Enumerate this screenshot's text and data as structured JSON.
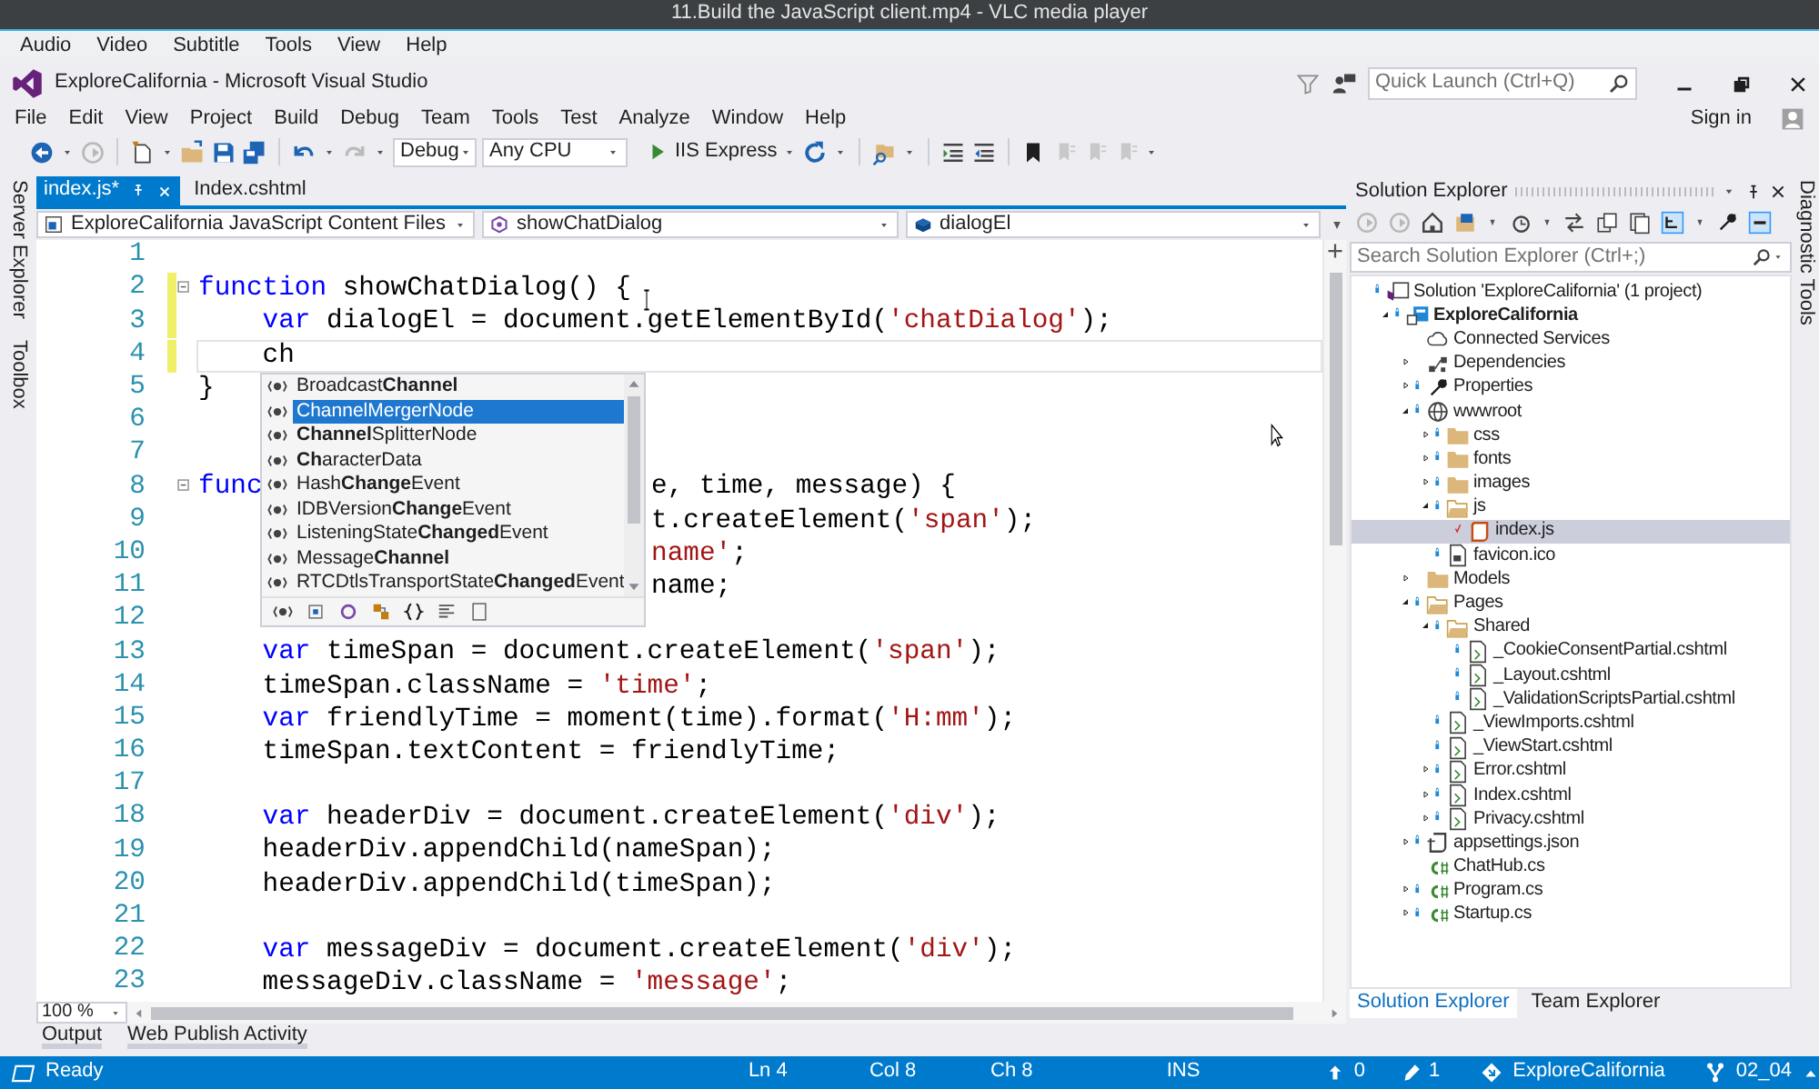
{
  "player": {
    "title": "11.Build the JavaScript client.mp4 - VLC media player",
    "menu": [
      "Audio",
      "Video",
      "Subtitle",
      "Tools",
      "View",
      "Help"
    ]
  },
  "ide": {
    "title": "ExploreCalifornia - Microsoft Visual Studio",
    "quick_launch": {
      "placeholder": "Quick Launch (Ctrl+Q)"
    },
    "sign_in": "Sign in",
    "menu": [
      "File",
      "Edit",
      "View",
      "Project",
      "Build",
      "Debug",
      "Team",
      "Tools",
      "Test",
      "Analyze",
      "Window",
      "Help"
    ],
    "toolbar": {
      "configuration": "Debug",
      "platform": "Any CPU",
      "run_target": "IIS Express"
    }
  },
  "left_strip": [
    "Server Explorer",
    "Toolbox"
  ],
  "right_strip": [
    "Diagnostic Tools"
  ],
  "editor_tabs": [
    {
      "label": "index.js*",
      "selected": true
    },
    {
      "label": "Index.cshtml",
      "selected": false
    }
  ],
  "navigation": [
    "ExploreCalifornia JavaScript Content Files",
    "showChatDialog",
    "dialogEl"
  ],
  "code_lines": [
    {
      "number": "1",
      "modified": false,
      "foldable": false,
      "current": false
    },
    {
      "number": "2",
      "modified": true,
      "foldable": true,
      "current": false,
      "tokens": [
        {
          "kind": "keyword",
          "text": "function"
        },
        {
          "kind": "text",
          "text": " showChatDialog() {"
        }
      ]
    },
    {
      "number": "3",
      "modified": true,
      "foldable": false,
      "current": false,
      "tokens": [
        {
          "kind": "keyword",
          "text": "    var"
        },
        {
          "kind": "text",
          "text": " dialogEl = document.getElementById("
        },
        {
          "kind": "string",
          "text": "'chatDialog'"
        },
        {
          "kind": "text",
          "text": ");"
        }
      ]
    },
    {
      "number": "4",
      "modified": true,
      "foldable": false,
      "current": true,
      "tokens": [
        {
          "kind": "text",
          "text": "    ch"
        }
      ]
    },
    {
      "number": "5",
      "modified": false,
      "foldable": false,
      "current": false,
      "tokens": [
        {
          "kind": "text",
          "text": "}"
        }
      ]
    },
    {
      "number": "6",
      "modified": false,
      "foldable": false,
      "current": false
    },
    {
      "number": "7",
      "modified": false,
      "foldable": false,
      "current": false
    },
    {
      "number": "8",
      "modified": false,
      "foldable": true,
      "current": false,
      "tokens": [
        {
          "kind": "keyword",
          "text": "func"
        }
      ],
      "after_popup": [
        {
          "kind": "text",
          "text": "e, time, message) {"
        }
      ]
    },
    {
      "number": "9",
      "modified": false,
      "foldable": false,
      "current": false,
      "after_popup": [
        {
          "kind": "text",
          "text": "t.createElement("
        },
        {
          "kind": "string",
          "text": "'span'"
        },
        {
          "kind": "text",
          "text": ");"
        }
      ]
    },
    {
      "number": "10",
      "modified": false,
      "foldable": false,
      "current": false,
      "after_popup": [
        {
          "kind": "string",
          "text": "name'"
        },
        {
          "kind": "text",
          "text": ";"
        }
      ]
    },
    {
      "number": "11",
      "modified": false,
      "foldable": false,
      "current": false,
      "after_popup": [
        {
          "kind": "text",
          "text": "name;"
        }
      ]
    },
    {
      "number": "12",
      "modified": false,
      "foldable": false,
      "current": false
    },
    {
      "number": "13",
      "modified": false,
      "foldable": false,
      "current": false,
      "tokens": [
        {
          "kind": "keyword",
          "text": "    var"
        },
        {
          "kind": "text",
          "text": " timeSpan = document.createElement("
        },
        {
          "kind": "string",
          "text": "'span'"
        },
        {
          "kind": "text",
          "text": ");"
        }
      ]
    },
    {
      "number": "14",
      "modified": false,
      "foldable": false,
      "current": false,
      "tokens": [
        {
          "kind": "text",
          "text": "    timeSpan.className = "
        },
        {
          "kind": "string",
          "text": "'time'"
        },
        {
          "kind": "text",
          "text": ";"
        }
      ]
    },
    {
      "number": "15",
      "modified": false,
      "foldable": false,
      "current": false,
      "tokens": [
        {
          "kind": "keyword",
          "text": "    var"
        },
        {
          "kind": "text",
          "text": " friendlyTime = moment(time).format("
        },
        {
          "kind": "string",
          "text": "'H:mm'"
        },
        {
          "kind": "text",
          "text": ");"
        }
      ]
    },
    {
      "number": "16",
      "modified": false,
      "foldable": false,
      "current": false,
      "tokens": [
        {
          "kind": "text",
          "text": "    timeSpan.textContent = friendlyTime;"
        }
      ]
    },
    {
      "number": "17",
      "modified": false,
      "foldable": false,
      "current": false
    },
    {
      "number": "18",
      "modified": false,
      "foldable": false,
      "current": false,
      "tokens": [
        {
          "kind": "keyword",
          "text": "    var"
        },
        {
          "kind": "text",
          "text": " headerDiv = document.createElement("
        },
        {
          "kind": "string",
          "text": "'div'"
        },
        {
          "kind": "text",
          "text": ");"
        }
      ]
    },
    {
      "number": "19",
      "modified": false,
      "foldable": false,
      "current": false,
      "tokens": [
        {
          "kind": "text",
          "text": "    headerDiv.appendChild(nameSpan);"
        }
      ]
    },
    {
      "number": "20",
      "modified": false,
      "foldable": false,
      "current": false,
      "tokens": [
        {
          "kind": "text",
          "text": "    headerDiv.appendChild(timeSpan);"
        }
      ]
    },
    {
      "number": "21",
      "modified": false,
      "foldable": false,
      "current": false
    },
    {
      "number": "22",
      "modified": false,
      "foldable": false,
      "current": false,
      "tokens": [
        {
          "kind": "keyword",
          "text": "    var"
        },
        {
          "kind": "text",
          "text": " messageDiv = document.createElement("
        },
        {
          "kind": "string",
          "text": "'div'"
        },
        {
          "kind": "text",
          "text": ");"
        }
      ]
    },
    {
      "number": "23",
      "modified": false,
      "foldable": false,
      "current": false,
      "tokens": [
        {
          "kind": "text",
          "text": "    messageDiv.className = "
        },
        {
          "kind": "string",
          "text": "'message'"
        },
        {
          "kind": "text",
          "text": ";"
        }
      ]
    }
  ],
  "completion": {
    "items": [
      {
        "text": "Broadcast**Channel**",
        "selected": false
      },
      {
        "text": "ChannelMergerNode",
        "selected": true
      },
      {
        "text": "**Channel**SplitterNode",
        "selected": false
      },
      {
        "text": "**Ch**aracterData",
        "selected": false
      },
      {
        "text": "Hash**Change**Event",
        "selected": false
      },
      {
        "text": "IDBVersion**Change**Event",
        "selected": false
      },
      {
        "text": "ListeningState**Changed**Event",
        "selected": false
      },
      {
        "text": "Message**Channel**",
        "selected": false
      },
      {
        "text": "RTCDtlsTransportState**Changed**Event",
        "selected": false
      }
    ]
  },
  "zoom": "100 %",
  "output_tabs": [
    "Output",
    "Web Publish Activity"
  ],
  "solution_explorer": {
    "title": "Solution Explorer",
    "search": {
      "placeholder": "Search Solution Explorer (Ctrl+;)"
    },
    "tree": [
      {
        "label": "Solution 'ExploreCalifornia' (1 project)",
        "kind": "solution",
        "locked": true,
        "pending": false,
        "selected": false,
        "children": [
          {
            "label": "ExploreCalifornia",
            "kind": "project",
            "expanded": true,
            "locked": true,
            "pending": false,
            "selected": false,
            "children": [
              {
                "label": "Connected Services",
                "kind": "cloud",
                "locked": false,
                "pending": false,
                "selected": false
              },
              {
                "label": "Dependencies",
                "kind": "dependencies",
                "expanded": false,
                "locked": false,
                "pending": false,
                "selected": false
              },
              {
                "label": "Properties",
                "kind": "wrench",
                "expanded": false,
                "locked": true,
                "pending": false,
                "selected": false
              },
              {
                "label": "wwwroot",
                "kind": "globe",
                "expanded": true,
                "locked": true,
                "pending": false,
                "selected": false,
                "children": [
                  {
                    "label": "css",
                    "kind": "folder",
                    "expanded": false,
                    "locked": true,
                    "pending": false,
                    "selected": false
                  },
                  {
                    "label": "fonts",
                    "kind": "folder",
                    "expanded": false,
                    "locked": true,
                    "pending": false,
                    "selected": false
                  },
                  {
                    "label": "images",
                    "kind": "folder",
                    "expanded": false,
                    "locked": true,
                    "pending": false,
                    "selected": false
                  },
                  {
                    "label": "js",
                    "kind": "folder-open",
                    "expanded": true,
                    "locked": true,
                    "pending": false,
                    "selected": false,
                    "children": [
                      {
                        "label": "index.js",
                        "kind": "script",
                        "locked": false,
                        "pending": true,
                        "selected": true
                      }
                    ]
                  },
                  {
                    "label": "favicon.ico",
                    "kind": "file",
                    "locked": true,
                    "pending": false,
                    "selected": false
                  }
                ]
              },
              {
                "label": "Models",
                "kind": "folder",
                "expanded": false,
                "locked": false,
                "pending": false,
                "selected": false
              },
              {
                "label": "Pages",
                "kind": "folder-open",
                "expanded": true,
                "locked": true,
                "pending": false,
                "selected": false,
                "children": [
                  {
                    "label": "Shared",
                    "kind": "folder-open",
                    "expanded": true,
                    "locked": true,
                    "pending": false,
                    "selected": false,
                    "children": [
                      {
                        "label": "_CookieConsentPartial.cshtml",
                        "kind": "page",
                        "locked": true,
                        "pending": false,
                        "selected": false
                      },
                      {
                        "label": "_Layout.cshtml",
                        "kind": "page",
                        "locked": true,
                        "pending": false,
                        "selected": false
                      },
                      {
                        "label": "_ValidationScriptsPartial.cshtml",
                        "kind": "page",
                        "locked": true,
                        "pending": false,
                        "selected": false
                      }
                    ]
                  },
                  {
                    "label": "_ViewImports.cshtml",
                    "kind": "page",
                    "locked": true,
                    "pending": false,
                    "selected": false
                  },
                  {
                    "label": "_ViewStart.cshtml",
                    "kind": "page",
                    "locked": true,
                    "pending": false,
                    "selected": false
                  },
                  {
                    "label": "Error.cshtml",
                    "kind": "page",
                    "expanded": false,
                    "locked": true,
                    "pending": false,
                    "selected": false
                  },
                  {
                    "label": "Index.cshtml",
                    "kind": "page",
                    "expanded": false,
                    "locked": true,
                    "pending": false,
                    "selected": false
                  },
                  {
                    "label": "Privacy.cshtml",
                    "kind": "page",
                    "expanded": false,
                    "locked": true,
                    "pending": false,
                    "selected": false
                  }
                ]
              },
              {
                "label": "appsettings.json",
                "kind": "json",
                "expanded": false,
                "locked": true,
                "pending": false,
                "selected": false
              },
              {
                "label": "ChatHub.cs",
                "kind": "csharp",
                "locked": false,
                "pending": false,
                "selected": false
              },
              {
                "label": "Program.cs",
                "kind": "csharp",
                "expanded": false,
                "locked": true,
                "pending": false,
                "selected": false
              },
              {
                "label": "Startup.cs",
                "kind": "csharp",
                "expanded": false,
                "locked": true,
                "pending": false,
                "selected": false
              }
            ]
          }
        ]
      }
    ],
    "tabs": [
      {
        "label": "Solution Explorer",
        "selected": true
      },
      {
        "label": "Team Explorer",
        "selected": false
      }
    ]
  },
  "status_bar": {
    "message": "Ready",
    "line": "Ln 4",
    "column": "Col 8",
    "char": "Ch 8",
    "mode": "INS",
    "pushes": "0",
    "changes": "1",
    "repository": "ExploreCalifornia",
    "branch": "02_04"
  }
}
